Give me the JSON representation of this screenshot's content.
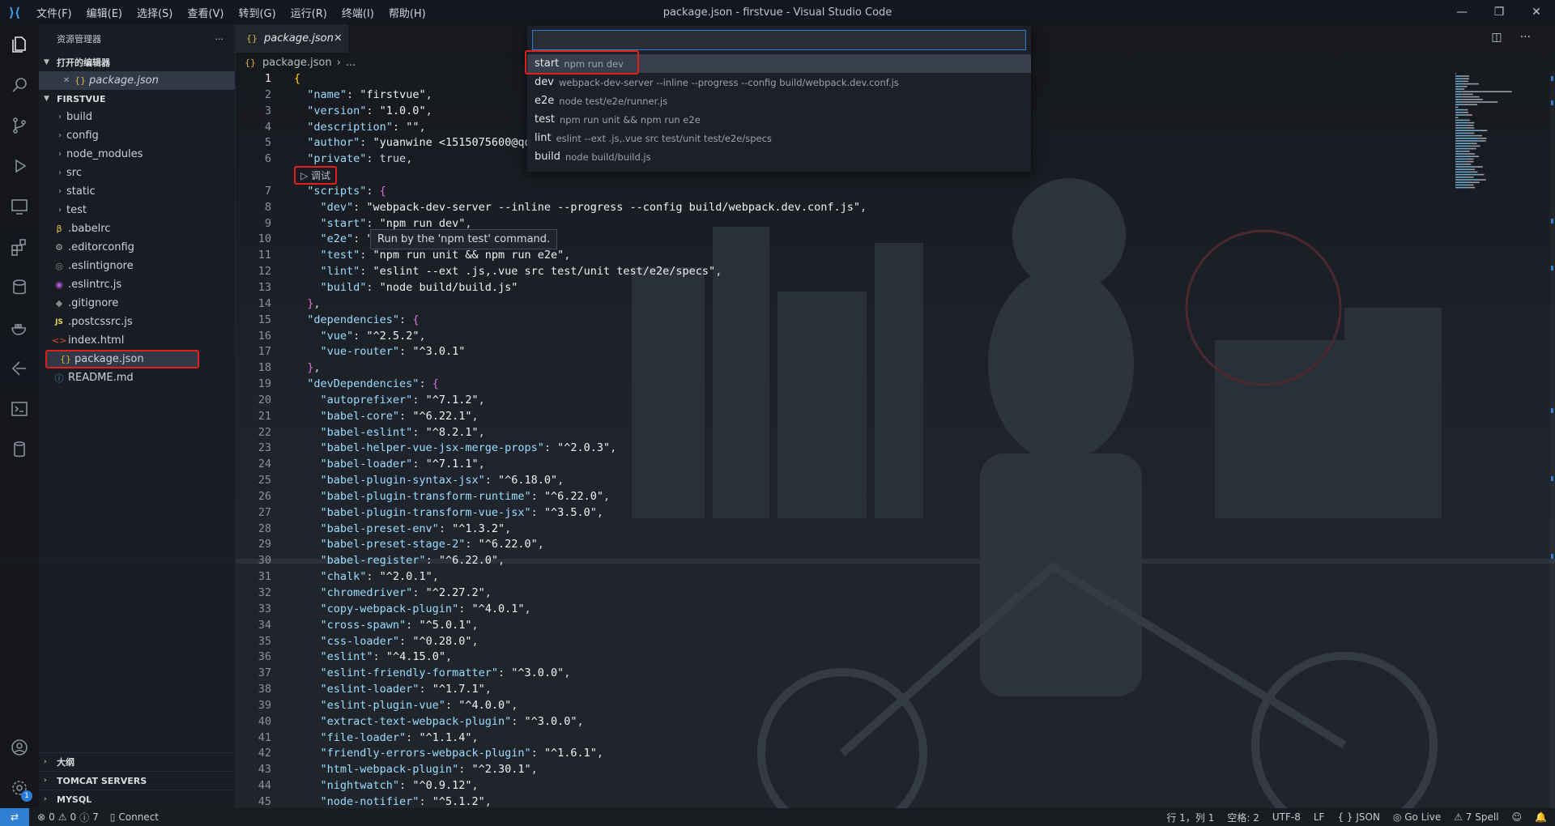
{
  "window": {
    "title": "package.json - firstvue - Visual Studio Code"
  },
  "menu": [
    "文件(F)",
    "编辑(E)",
    "选择(S)",
    "查看(V)",
    "转到(G)",
    "运行(R)",
    "终端(I)",
    "帮助(H)"
  ],
  "sidebar": {
    "title": "资源管理器",
    "open_editors": {
      "label": "打开的编辑器",
      "files": [
        {
          "name": "package.json"
        }
      ]
    },
    "project": {
      "label": "FIRSTVUE"
    },
    "folders": [
      "build",
      "config",
      "node_modules",
      "src",
      "static",
      "test"
    ],
    "files": [
      ".babelrc",
      ".editorconfig",
      ".eslintignore",
      ".eslintrc.js",
      ".gitignore",
      ".postcssrc.js",
      "index.html",
      "package.json",
      "README.md"
    ],
    "bottom_sections": [
      "大纲",
      "TOMCAT SERVERS",
      "MYSQL"
    ]
  },
  "editor": {
    "tab": "package.json",
    "breadcrumb": [
      "package.json",
      "..."
    ],
    "codelens": "▷ 调试",
    "tooltip": "Run by the 'npm test' command.",
    "lines": [
      [
        [
          "b1",
          "{"
        ]
      ],
      [
        [
          "k",
          "  \"name\""
        ],
        [
          "p",
          ": "
        ],
        [
          "s",
          "\"firstvue\""
        ],
        [
          "p",
          ","
        ]
      ],
      [
        [
          "k",
          "  \"version\""
        ],
        [
          "p",
          ": "
        ],
        [
          "s",
          "\"1.0.0\""
        ],
        [
          "p",
          ","
        ]
      ],
      [
        [
          "k",
          "  \"description\""
        ],
        [
          "p",
          ": "
        ],
        [
          "s",
          "\"\""
        ],
        [
          "p",
          ","
        ]
      ],
      [
        [
          "k",
          "  \"author\""
        ],
        [
          "p",
          ": "
        ],
        [
          "s",
          "\"yuanwine <1515075600@qq"
        ]
      ],
      [
        [
          "k",
          "  \"private\""
        ],
        [
          "p",
          ": "
        ],
        [
          "kw",
          "true"
        ],
        [
          "p",
          ","
        ]
      ],
      [
        [
          "k",
          "  \"scripts\""
        ],
        [
          "p",
          ": "
        ],
        [
          "b2",
          "{"
        ]
      ],
      [
        [
          "k",
          "    \"dev\""
        ],
        [
          "p",
          ": "
        ],
        [
          "s",
          "\"webpack-dev-server --inline --progress --config build/webpack.dev.conf.js\""
        ],
        [
          "p",
          ","
        ]
      ],
      [
        [
          "k",
          "    \"start\""
        ],
        [
          "p",
          ": "
        ],
        [
          "s",
          "\"npm run dev\""
        ],
        [
          "p",
          ","
        ]
      ],
      [
        [
          "k",
          "    \"e2e\""
        ],
        [
          "p",
          ": "
        ],
        [
          "s",
          "\"node test/e2e/runner.js\""
        ],
        [
          "p",
          ","
        ]
      ],
      [
        [
          "k",
          "    \"test\""
        ],
        [
          "p",
          ": "
        ],
        [
          "s",
          "\"npm run unit && npm run e2e\""
        ],
        [
          "p",
          ","
        ]
      ],
      [
        [
          "k",
          "    \"lint\""
        ],
        [
          "p",
          ": "
        ],
        [
          "s",
          "\"eslint --ext .js,.vue src test/unit test/e2e/specs\""
        ],
        [
          "p",
          ","
        ]
      ],
      [
        [
          "k",
          "    \"build\""
        ],
        [
          "p",
          ": "
        ],
        [
          "s",
          "\"node build/build.js\""
        ]
      ],
      [
        [
          "b2",
          "  }"
        ],
        [
          "p",
          ","
        ]
      ],
      [
        [
          "k",
          "  \"dependencies\""
        ],
        [
          "p",
          ": "
        ],
        [
          "b2",
          "{"
        ]
      ],
      [
        [
          "k",
          "    \"vue\""
        ],
        [
          "p",
          ": "
        ],
        [
          "s",
          "\"^2.5.2\""
        ],
        [
          "p",
          ","
        ]
      ],
      [
        [
          "k",
          "    \"vue-router\""
        ],
        [
          "p",
          ": "
        ],
        [
          "s",
          "\"^3.0.1\""
        ]
      ],
      [
        [
          "b2",
          "  }"
        ],
        [
          "p",
          ","
        ]
      ],
      [
        [
          "k",
          "  \"devDependencies\""
        ],
        [
          "p",
          ": "
        ],
        [
          "b2",
          "{"
        ]
      ],
      [
        [
          "k",
          "    \"autoprefixer\""
        ],
        [
          "p",
          ": "
        ],
        [
          "s",
          "\"^7.1.2\""
        ],
        [
          "p",
          ","
        ]
      ],
      [
        [
          "k",
          "    \"babel-core\""
        ],
        [
          "p",
          ": "
        ],
        [
          "s",
          "\"^6.22.1\""
        ],
        [
          "p",
          ","
        ]
      ],
      [
        [
          "k",
          "    \"babel-eslint\""
        ],
        [
          "p",
          ": "
        ],
        [
          "s",
          "\"^8.2.1\""
        ],
        [
          "p",
          ","
        ]
      ],
      [
        [
          "k",
          "    \"babel-helper-vue-jsx-merge-props\""
        ],
        [
          "p",
          ": "
        ],
        [
          "s",
          "\"^2.0.3\""
        ],
        [
          "p",
          ","
        ]
      ],
      [
        [
          "k",
          "    \"babel-loader\""
        ],
        [
          "p",
          ": "
        ],
        [
          "s",
          "\"^7.1.1\""
        ],
        [
          "p",
          ","
        ]
      ],
      [
        [
          "k",
          "    \"babel-plugin-syntax-jsx\""
        ],
        [
          "p",
          ": "
        ],
        [
          "s",
          "\"^6.18.0\""
        ],
        [
          "p",
          ","
        ]
      ],
      [
        [
          "k",
          "    \"babel-plugin-transform-runtime\""
        ],
        [
          "p",
          ": "
        ],
        [
          "s",
          "\"^6.22.0\""
        ],
        [
          "p",
          ","
        ]
      ],
      [
        [
          "k",
          "    \"babel-plugin-transform-vue-jsx\""
        ],
        [
          "p",
          ": "
        ],
        [
          "s",
          "\"^3.5.0\""
        ],
        [
          "p",
          ","
        ]
      ],
      [
        [
          "k",
          "    \"babel-preset-env\""
        ],
        [
          "p",
          ": "
        ],
        [
          "s",
          "\"^1.3.2\""
        ],
        [
          "p",
          ","
        ]
      ],
      [
        [
          "k",
          "    \"babel-preset-stage-2\""
        ],
        [
          "p",
          ": "
        ],
        [
          "s",
          "\"^6.22.0\""
        ],
        [
          "p",
          ","
        ]
      ],
      [
        [
          "k",
          "    \"babel-register\""
        ],
        [
          "p",
          ": "
        ],
        [
          "s",
          "\"^6.22.0\""
        ],
        [
          "p",
          ","
        ]
      ],
      [
        [
          "k",
          "    \"chalk\""
        ],
        [
          "p",
          ": "
        ],
        [
          "s",
          "\"^2.0.1\""
        ],
        [
          "p",
          ","
        ]
      ],
      [
        [
          "k",
          "    \"chromedriver\""
        ],
        [
          "p",
          ": "
        ],
        [
          "s",
          "\"^2.27.2\""
        ],
        [
          "p",
          ","
        ]
      ],
      [
        [
          "k",
          "    \"copy-webpack-plugin\""
        ],
        [
          "p",
          ": "
        ],
        [
          "s",
          "\"^4.0.1\""
        ],
        [
          "p",
          ","
        ]
      ],
      [
        [
          "k",
          "    \"cross-spawn\""
        ],
        [
          "p",
          ": "
        ],
        [
          "s",
          "\"^5.0.1\""
        ],
        [
          "p",
          ","
        ]
      ],
      [
        [
          "k",
          "    \"css-loader\""
        ],
        [
          "p",
          ": "
        ],
        [
          "s",
          "\"^0.28.0\""
        ],
        [
          "p",
          ","
        ]
      ],
      [
        [
          "k",
          "    \"eslint\""
        ],
        [
          "p",
          ": "
        ],
        [
          "s",
          "\"^4.15.0\""
        ],
        [
          "p",
          ","
        ]
      ],
      [
        [
          "k",
          "    \"eslint-friendly-formatter\""
        ],
        [
          "p",
          ": "
        ],
        [
          "s",
          "\"^3.0.0\""
        ],
        [
          "p",
          ","
        ]
      ],
      [
        [
          "k",
          "    \"eslint-loader\""
        ],
        [
          "p",
          ": "
        ],
        [
          "s",
          "\"^1.7.1\""
        ],
        [
          "p",
          ","
        ]
      ],
      [
        [
          "k",
          "    \"eslint-plugin-vue\""
        ],
        [
          "p",
          ": "
        ],
        [
          "s",
          "\"^4.0.0\""
        ],
        [
          "p",
          ","
        ]
      ],
      [
        [
          "k",
          "    \"extract-text-webpack-plugin\""
        ],
        [
          "p",
          ": "
        ],
        [
          "s",
          "\"^3.0.0\""
        ],
        [
          "p",
          ","
        ]
      ],
      [
        [
          "k",
          "    \"file-loader\""
        ],
        [
          "p",
          ": "
        ],
        [
          "s",
          "\"^1.1.4\""
        ],
        [
          "p",
          ","
        ]
      ],
      [
        [
          "k",
          "    \"friendly-errors-webpack-plugin\""
        ],
        [
          "p",
          ": "
        ],
        [
          "s",
          "\"^1.6.1\""
        ],
        [
          "p",
          ","
        ]
      ],
      [
        [
          "k",
          "    \"html-webpack-plugin\""
        ],
        [
          "p",
          ": "
        ],
        [
          "s",
          "\"^2.30.1\""
        ],
        [
          "p",
          ","
        ]
      ],
      [
        [
          "k",
          "    \"nightwatch\""
        ],
        [
          "p",
          ": "
        ],
        [
          "s",
          "\"^0.9.12\""
        ],
        [
          "p",
          ","
        ]
      ],
      [
        [
          "k",
          "    \"node-notifier\""
        ],
        [
          "p",
          ": "
        ],
        [
          "s",
          "\"^5.1.2\""
        ],
        [
          "p",
          ","
        ]
      ]
    ]
  },
  "quickpick": {
    "input_value": "",
    "items": [
      {
        "name": "start",
        "desc": "npm run dev"
      },
      {
        "name": "dev",
        "desc": "webpack-dev-server --inline --progress --config build/webpack.dev.conf.js"
      },
      {
        "name": "e2e",
        "desc": "node test/e2e/runner.js"
      },
      {
        "name": "test",
        "desc": "npm run unit && npm run e2e"
      },
      {
        "name": "lint",
        "desc": "eslint --ext .js,.vue src test/unit test/e2e/specs"
      },
      {
        "name": "build",
        "desc": "node build/build.js"
      }
    ]
  },
  "status": {
    "errors": "0",
    "warnings": "0",
    "infos": "7",
    "connect": "Connect",
    "position": "行 1，列 1",
    "spaces": "空格: 2",
    "encoding": "UTF-8",
    "eol": "LF",
    "language": "{ } JSON",
    "golive": "Go Live",
    "spell": "7 Spell"
  },
  "colors": {
    "accent": "#2f7fd1",
    "highlight_box": "#e0201b"
  }
}
